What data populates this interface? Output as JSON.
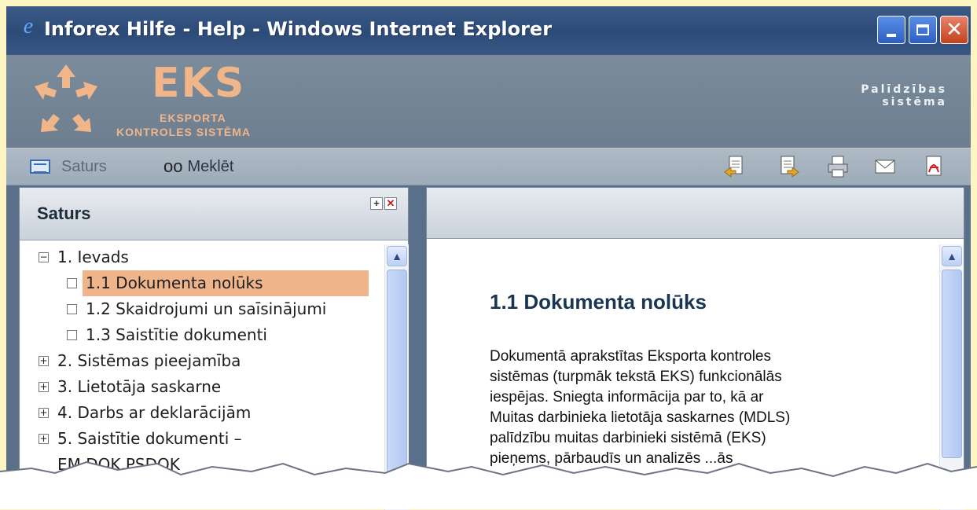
{
  "window": {
    "title": "Inforex Hilfe - Help - Windows Internet Explorer",
    "min_glyph": "",
    "max_glyph": "",
    "close_glyph": "✕"
  },
  "header": {
    "logo_text": "EKS",
    "logo_sub1": "EKSPORTA",
    "logo_sub2": "KONTROLES SISTĒMA",
    "help_line1": "Palīdzības",
    "help_line2": "sistēma"
  },
  "toolbar": {
    "saturs_label": "Saturs",
    "meklet_label": "Meklēt",
    "icons": [
      "previous-page-icon",
      "next-page-icon",
      "print-icon",
      "email-icon",
      "pdf-icon"
    ]
  },
  "toc": {
    "title": "Saturs",
    "items": [
      {
        "label": "1. Ievads",
        "toggle": "−"
      },
      {
        "label": "1.1 Dokumenta nolūks"
      },
      {
        "label": "1.2 Skaidrojumi un saīsinājumi"
      },
      {
        "label": "1.3 Saistītie dokumenti"
      },
      {
        "label": "2. Sistēmas pieejamība",
        "toggle": "+"
      },
      {
        "label": "3. Lietotāja saskarne",
        "toggle": "+"
      },
      {
        "label": "4. Darbs ar deklarācijām",
        "toggle": "+"
      },
      {
        "label": "5. Saistītie dokumenti –",
        "toggle": "+"
      },
      {
        "label": "EM.DOK,PSDOK"
      }
    ]
  },
  "content": {
    "heading": "1.1 Dokumenta nolūks",
    "lines": [
      "Dokumentā aprakstītas Eksporta kontroles",
      "sistēmas (turpmāk tekstā EKS) funkcionālās",
      "iespējas. Sniegta informācija par to, kā ar",
      "Muitas darbinieka lietotāja saskarnes (MDLS)",
      "palīdzību muitas darbinieki sistēmā (EKS)",
      "pieņems, pārbaudīs un analizēs ...ās"
    ]
  },
  "colors": {
    "accent": "#f0b48b",
    "titlebar": "#2c4b78",
    "background": "#fdf6c4"
  }
}
